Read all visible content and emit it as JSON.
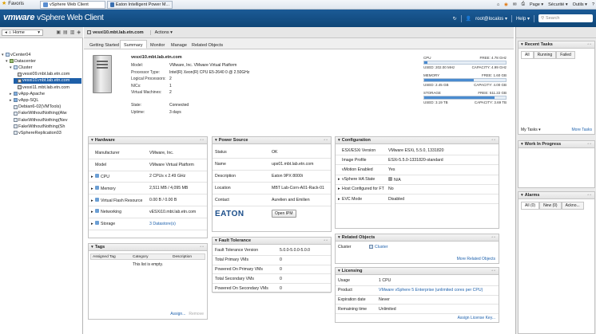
{
  "browser": {
    "favorites": "Favoris",
    "tabs": [
      "vSphere Web Client",
      "Eaton Intelligent Power M..."
    ],
    "tools": [
      "Page ▾",
      "Sécurité ▾",
      "Outils ▾"
    ]
  },
  "header": {
    "brand": "vmware",
    "product": "vSphere Web Client",
    "user": "root@localos ▾",
    "help": "Help ▾",
    "search_placeholder": "Search"
  },
  "nav": {
    "home": "Home",
    "tree": [
      {
        "label": "vCenter04",
        "icon": "vcenter-icon",
        "indent": 0,
        "twisty": "▾"
      },
      {
        "label": "Datacenter",
        "icon": "datacenter-icon",
        "indent": 1,
        "twisty": "▾"
      },
      {
        "label": "Cluster",
        "icon": "cluster-icon",
        "indent": 2,
        "twisty": "▾"
      },
      {
        "label": "vesxi09.mbt.lab.etn.com",
        "icon": "host-icon",
        "indent": 3,
        "twisty": ""
      },
      {
        "label": "vesxi10.mbt.lab.etn.com",
        "icon": "host-icon",
        "indent": 3,
        "twisty": "",
        "selected": true
      },
      {
        "label": "vesxi11.mbt.lab.etn.com",
        "icon": "host-icon",
        "indent": 3,
        "twisty": ""
      },
      {
        "label": "vApp-Apache",
        "icon": "vapp-icon",
        "indent": 2,
        "twisty": "▸"
      },
      {
        "label": "vApp-SQL",
        "icon": "vapp-icon",
        "indent": 2,
        "twisty": "▸"
      },
      {
        "label": "Debian6-02(VMTools)",
        "icon": "vm-icon",
        "indent": 2,
        "twisty": ""
      },
      {
        "label": "FakeWithoutNothing(Alw",
        "icon": "vm-icon",
        "indent": 2,
        "twisty": ""
      },
      {
        "label": "FakeWithoutNothing(Nev",
        "icon": "vm-icon",
        "indent": 2,
        "twisty": ""
      },
      {
        "label": "FakeWithoutNothing(Sh",
        "icon": "vm-icon",
        "indent": 2,
        "twisty": ""
      },
      {
        "label": "vSphereReplication03",
        "icon": "vm-icon",
        "indent": 2,
        "twisty": ""
      }
    ]
  },
  "object": {
    "name": "vesxi10.mbt.lab.etn.com",
    "actions": "Actions ▾",
    "tabs": [
      "Getting Started",
      "Summary",
      "Monitor",
      "Manage",
      "Related Objects"
    ],
    "active_tab": "Summary"
  },
  "summary": {
    "title": "vesxi10.mbt.lab.etn.com",
    "props": [
      {
        "k": "Model:",
        "v": "VMware, Inc. VMware Virtual Platform"
      },
      {
        "k": "Processor Type:",
        "v": "Intel(R) Xeon(R) CPU E5-2640 0 @ 2.50GHz"
      },
      {
        "k": "Logical Processors:",
        "v": "2"
      },
      {
        "k": "NICs:",
        "v": "1"
      },
      {
        "k": "Virtual Machines:",
        "v": "2"
      }
    ],
    "state_props": [
      {
        "k": "State:",
        "v": "Connected"
      },
      {
        "k": "Uptime:",
        "v": "3 days"
      }
    ],
    "meters": [
      {
        "name": "CPU",
        "free": "FREE: 4.78 GHz",
        "used": "USED: 202.00 MHz",
        "cap": "CAPACITY: 4.99 GHz",
        "level": 0.04
      },
      {
        "name": "MEMORY",
        "free": "FREE: 1.60 GB",
        "used": "USED: 2.45 GB",
        "cap": "CAPACITY: 4.00 GB",
        "level": 0.61
      },
      {
        "name": "STORAGE",
        "free": "FREE: 511.22 GB",
        "used": "USED: 3.19 TB",
        "cap": "CAPACITY: 3.69 TB",
        "level": 0.86
      }
    ]
  },
  "hardware": {
    "title": "Hardware",
    "rows": [
      {
        "k": "Manufacturer",
        "v": "VMware, Inc.",
        "icon": "",
        "exp": ""
      },
      {
        "k": "Model",
        "v": "VMware Virtual Platform",
        "icon": "",
        "exp": ""
      },
      {
        "k": "CPU",
        "v": "2 CPUs x 2.49 GHz",
        "icon": "cpu-icon",
        "exp": "▸"
      },
      {
        "k": "Memory",
        "v": "2,511 MB / 4,095 MB",
        "icon": "memory-icon",
        "exp": "▸"
      },
      {
        "k": "Virtual Flash Resource",
        "v": "0.00 B / 0.00 B",
        "icon": "flash-icon",
        "exp": "▸"
      },
      {
        "k": "Networking",
        "v": "vESXi10.mbt.lab.etn.com",
        "icon": "network-icon",
        "exp": "▸"
      },
      {
        "k": "Storage",
        "v": "3 Datastore(s)",
        "icon": "storage-icon",
        "exp": "▸",
        "link": true
      }
    ]
  },
  "power": {
    "title": "Power Source",
    "rows": [
      {
        "k": "Status",
        "v": "OK"
      },
      {
        "k": "Name",
        "v": "ups01.mbt.lab.etn.com"
      },
      {
        "k": "Description",
        "v": "Eaton 9PX 8000i"
      },
      {
        "k": "Location",
        "v": "MBT Lab-Corn-A01-Rack-01"
      },
      {
        "k": "Contact",
        "v": "Aurelien and Emilien"
      }
    ],
    "logo": "EATON",
    "open_btn": "Open IPM"
  },
  "fault": {
    "title": "Fault Tolerance",
    "rows": [
      {
        "k": "Fault Tolerance Version",
        "v": "5.0.0-5.0.0-5.0.0"
      },
      {
        "k": "Total Primary VMs",
        "v": "0"
      },
      {
        "k": "Powered On Primary VMs",
        "v": "0"
      },
      {
        "k": "Total Secondary VMs",
        "v": "0"
      },
      {
        "k": "Powered On Secondary VMs",
        "v": "0"
      }
    ]
  },
  "tags": {
    "title": "Tags",
    "cols": [
      "Assigned Tag",
      "Category",
      "Description"
    ],
    "empty": "This list is empty.",
    "assign": "Assign...",
    "remove": "Remove"
  },
  "config": {
    "title": "Configuration",
    "rows": [
      {
        "k": "ESX/ESXi Version",
        "v": "VMware ESXi, 5.5.0, 1331820",
        "exp": ""
      },
      {
        "k": "Image Profile",
        "v": "ESXi-5.5.0-1331820-standard",
        "exp": ""
      },
      {
        "k": "vMotion Enabled",
        "v": "Yes",
        "exp": ""
      },
      {
        "k": "vSphere HA State",
        "v": "N/A",
        "exp": "▸",
        "icon": true
      },
      {
        "k": "Host Configured for FT",
        "v": "No",
        "exp": "▸"
      },
      {
        "k": "EVC Mode",
        "v": "Disabled",
        "exp": "▸"
      }
    ]
  },
  "related": {
    "title": "Related Objects",
    "cluster_k": "Cluster",
    "cluster_v": "Cluster",
    "more": "More Related Objects"
  },
  "licensing": {
    "title": "Licensing",
    "rows": [
      {
        "k": "Usage",
        "v": "1 CPU"
      },
      {
        "k": "Product",
        "v": "VMware vSphere 5 Enterprise (unlimited cores per CPU)",
        "link": true
      },
      {
        "k": "Expiration date",
        "v": "Never"
      },
      {
        "k": "Remaining time",
        "v": "Unlimited"
      }
    ],
    "assign": "Assign License Key..."
  },
  "right": {
    "recent_tasks": {
      "title": "Recent Tasks",
      "tabs": [
        "All",
        "Running",
        "Failed"
      ],
      "my_tasks": "My Tasks ▾",
      "more": "More Tasks"
    },
    "wip": {
      "title": "Work In Progress"
    },
    "alarms": {
      "title": "Alarms",
      "tabs": [
        "All (0)",
        "New (0)",
        "Ackno..."
      ]
    }
  }
}
